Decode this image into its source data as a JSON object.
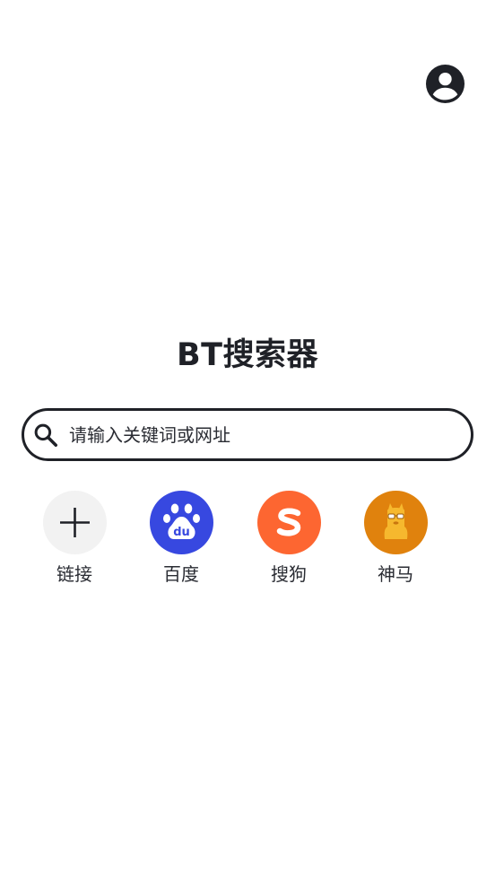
{
  "header": {
    "avatar_icon": "account-circle-icon"
  },
  "page_title": "BT搜索器",
  "search": {
    "icon": "search-icon",
    "placeholder": "请输入关键词或网址",
    "value": ""
  },
  "shortcuts": [
    {
      "label": "链接",
      "icon": "plus-icon",
      "color": "#f2f2f2"
    },
    {
      "label": "百度",
      "icon": "baidu-paw-icon",
      "color": "#3748e0"
    },
    {
      "label": "搜狗",
      "icon": "sogou-s-icon",
      "color": "#fd6631"
    },
    {
      "label": "神马",
      "icon": "shenma-alpaca-icon",
      "color": "#e0820d"
    }
  ],
  "colors": {
    "text": "#1f2127",
    "background": "#ffffff"
  }
}
